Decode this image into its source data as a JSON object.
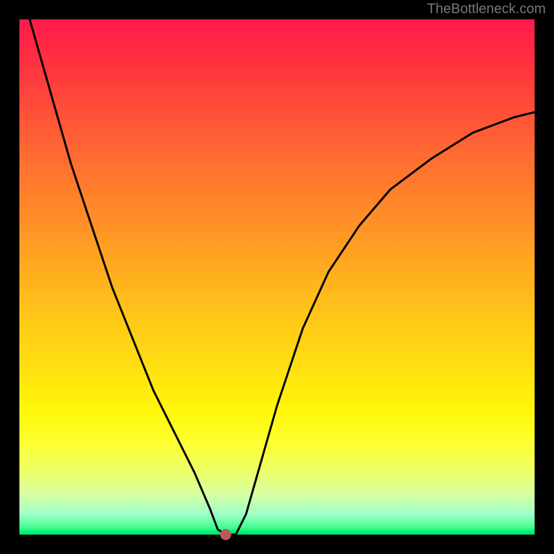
{
  "attribution": "TheBottleneck.com",
  "chart_data": {
    "type": "line",
    "title": "",
    "subtitle": "",
    "xlabel": "",
    "ylabel": "",
    "xlim": [
      0,
      100
    ],
    "ylim": [
      0,
      100
    ],
    "grid": false,
    "legend": false,
    "background_gradient": {
      "direction": "vertical",
      "stops": [
        {
          "pos": 0.0,
          "color": "#ff1a4a",
          "meaning": "high-bottleneck"
        },
        {
          "pos": 0.5,
          "color": "#ffc818",
          "meaning": "medium"
        },
        {
          "pos": 1.0,
          "color": "#00e070",
          "meaning": "no-bottleneck"
        }
      ]
    },
    "series": [
      {
        "name": "bottleneck-curve",
        "color": "#000000",
        "x": [
          0,
          2,
          6,
          10,
          14,
          18,
          22,
          26,
          30,
          34,
          37,
          38.5,
          40,
          42,
          44,
          46,
          50,
          55,
          60,
          66,
          72,
          80,
          88,
          96,
          100
        ],
        "y": [
          108,
          100,
          86,
          72,
          60,
          48,
          38,
          28,
          20,
          12,
          5,
          1,
          0,
          0,
          4,
          11,
          25,
          40,
          51,
          60,
          67,
          73,
          78,
          81,
          82
        ]
      }
    ],
    "markers": [
      {
        "name": "optimal-point",
        "x": 40,
        "y": 0,
        "color": "#b85a58"
      }
    ],
    "flat_bottom": {
      "x_start": 38.5,
      "x_end": 42,
      "y": 0
    }
  }
}
